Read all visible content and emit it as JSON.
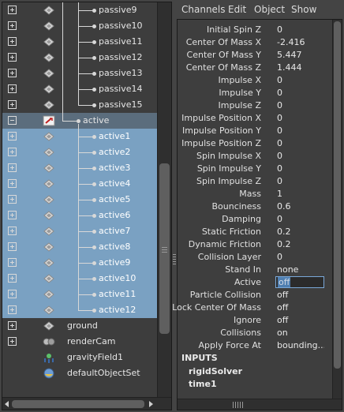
{
  "outliner": {
    "rows": [
      {
        "label": "passive9",
        "expander": "plus",
        "state": "normal"
      },
      {
        "label": "passive10",
        "expander": "plus",
        "state": "normal"
      },
      {
        "label": "passive11",
        "expander": "plus",
        "state": "normal"
      },
      {
        "label": "passive12",
        "expander": "plus",
        "state": "normal"
      },
      {
        "label": "passive13",
        "expander": "plus",
        "state": "normal"
      },
      {
        "label": "passive14",
        "expander": "plus",
        "state": "normal"
      },
      {
        "label": "passive15",
        "expander": "plus",
        "state": "normal"
      },
      {
        "label": "active",
        "expander": "minus",
        "state": "highlight"
      },
      {
        "label": "active1",
        "expander": "plus",
        "state": "selected"
      },
      {
        "label": "active2",
        "expander": "plus",
        "state": "selected"
      },
      {
        "label": "active3",
        "expander": "plus",
        "state": "selected"
      },
      {
        "label": "active4",
        "expander": "plus",
        "state": "selected"
      },
      {
        "label": "active5",
        "expander": "plus",
        "state": "selected"
      },
      {
        "label": "active6",
        "expander": "plus",
        "state": "selected"
      },
      {
        "label": "active7",
        "expander": "plus",
        "state": "selected"
      },
      {
        "label": "active8",
        "expander": "plus",
        "state": "selected"
      },
      {
        "label": "active9",
        "expander": "plus",
        "state": "selected"
      },
      {
        "label": "active10",
        "expander": "plus",
        "state": "selected"
      },
      {
        "label": "active11",
        "expander": "plus",
        "state": "selected"
      },
      {
        "label": "active12",
        "expander": "plus",
        "state": "selected"
      },
      {
        "label": "ground",
        "expander": "plus",
        "state": "normal"
      },
      {
        "label": "renderCam",
        "expander": "plus",
        "state": "normal"
      },
      {
        "label": "gravityField1",
        "expander": "none",
        "state": "normal"
      },
      {
        "label": "defaultObjectSet",
        "expander": "none",
        "state": "normal"
      }
    ]
  },
  "menu": [
    "Channels",
    "Edit",
    "Object",
    "Show"
  ],
  "channels": [
    {
      "label": "Initial Spin Z",
      "value": "0"
    },
    {
      "label": "Center Of Mass X",
      "value": "-2.416"
    },
    {
      "label": "Center Of Mass Y",
      "value": "5.447"
    },
    {
      "label": "Center Of Mass Z",
      "value": "1.444"
    },
    {
      "label": "Impulse X",
      "value": "0"
    },
    {
      "label": "Impulse Y",
      "value": "0"
    },
    {
      "label": "Impulse Z",
      "value": "0"
    },
    {
      "label": "Impulse Position X",
      "value": "0"
    },
    {
      "label": "Impulse Position Y",
      "value": "0"
    },
    {
      "label": "Impulse Position Z",
      "value": "0"
    },
    {
      "label": "Spin Impulse X",
      "value": "0"
    },
    {
      "label": "Spin Impulse Y",
      "value": "0"
    },
    {
      "label": "Spin Impulse Z",
      "value": "0"
    },
    {
      "label": "Mass",
      "value": "1"
    },
    {
      "label": "Bounciness",
      "value": "0.6"
    },
    {
      "label": "Damping",
      "value": "0"
    },
    {
      "label": "Static Friction",
      "value": "0.2"
    },
    {
      "label": "Dynamic Friction",
      "value": "0.2"
    },
    {
      "label": "Collision Layer",
      "value": "0"
    },
    {
      "label": "Stand In",
      "value": "none"
    },
    {
      "label": "Active",
      "value": "off",
      "editing": true
    },
    {
      "label": "Particle Collision",
      "value": "off"
    },
    {
      "label": "Lock Center Of Mass",
      "value": "off"
    },
    {
      "label": "Ignore",
      "value": "off"
    },
    {
      "label": "Collisions",
      "value": "on"
    },
    {
      "label": "Apply Force At",
      "value": "bounding..."
    }
  ],
  "inputs": {
    "header": "INPUTS",
    "items": [
      "rigidSolver",
      "time1"
    ]
  },
  "colors": {
    "selection": "#7aa1c2",
    "highlight": "#5b6d7d",
    "panel": "#3d3d3d",
    "field_focus": "#7aa8d8"
  }
}
